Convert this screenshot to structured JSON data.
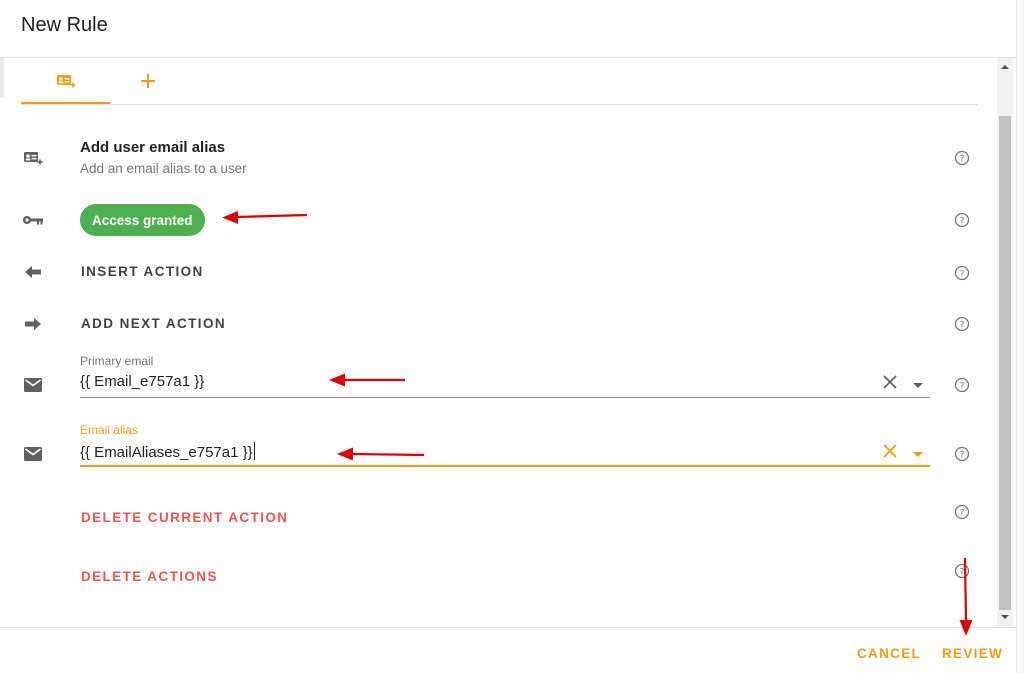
{
  "dialog": {
    "title": "New Rule"
  },
  "tabs": [
    {
      "icon": "user-card-add-icon"
    },
    {
      "icon": "plus-icon"
    }
  ],
  "action": {
    "icon": "user-card-add-icon",
    "title": "Add user email alias",
    "subtitle": "Add an email alias to a user"
  },
  "access": {
    "icon": "key-icon",
    "chip_label": "Access granted"
  },
  "buttons": {
    "insert_action": "INSERT ACTION",
    "add_next_action": "ADD NEXT ACTION",
    "delete_current_action": "DELETE CURRENT ACTION",
    "delete_actions": "DELETE ACTIONS"
  },
  "fields": {
    "primary_email": {
      "label": "Primary email",
      "value": "{{ Email_e757a1 }}",
      "icon": "mail-icon"
    },
    "email_alias": {
      "label": "Email alias",
      "value": "{{ EmailAliases_e757a1 }}",
      "icon": "mail-icon",
      "focused": true
    }
  },
  "footer": {
    "cancel": "CANCEL",
    "review": "REVIEW"
  },
  "colors": {
    "accent": "#f39c12",
    "success": "#4caf50",
    "danger": "#ef5350",
    "annotation": "#e00000"
  }
}
